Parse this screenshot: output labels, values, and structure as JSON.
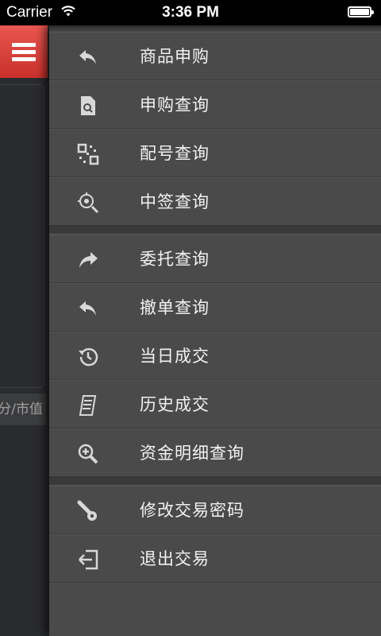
{
  "status_bar": {
    "carrier": "Carrier",
    "time": "3:36 PM"
  },
  "background_page": {
    "menu_icon": "hamburger-menu-icon",
    "hint_text": "分/市值"
  },
  "menu": {
    "groups": [
      [
        {
          "label": "商品申购",
          "icon": "reply-arrow-icon"
        },
        {
          "label": "申购查询",
          "icon": "document-search-icon"
        },
        {
          "label": "配号查询",
          "icon": "qr-code-icon"
        },
        {
          "label": "中签查询",
          "icon": "target-search-icon"
        }
      ],
      [
        {
          "label": "委托查询",
          "icon": "forward-arrow-icon"
        },
        {
          "label": "撤单查询",
          "icon": "undo-arrow-icon"
        },
        {
          "label": "当日成交",
          "icon": "history-clock-icon"
        },
        {
          "label": "历史成交",
          "icon": "receipt-icon"
        },
        {
          "label": "资金明细查询",
          "icon": "zoom-in-icon"
        }
      ],
      [
        {
          "label": "修改交易密码",
          "icon": "key-icon"
        },
        {
          "label": "退出交易",
          "icon": "exit-door-icon"
        }
      ]
    ]
  },
  "colors": {
    "accent": "#d9413b",
    "drawer_bg": "#4a4a4a",
    "text": "#f2f2f2"
  }
}
